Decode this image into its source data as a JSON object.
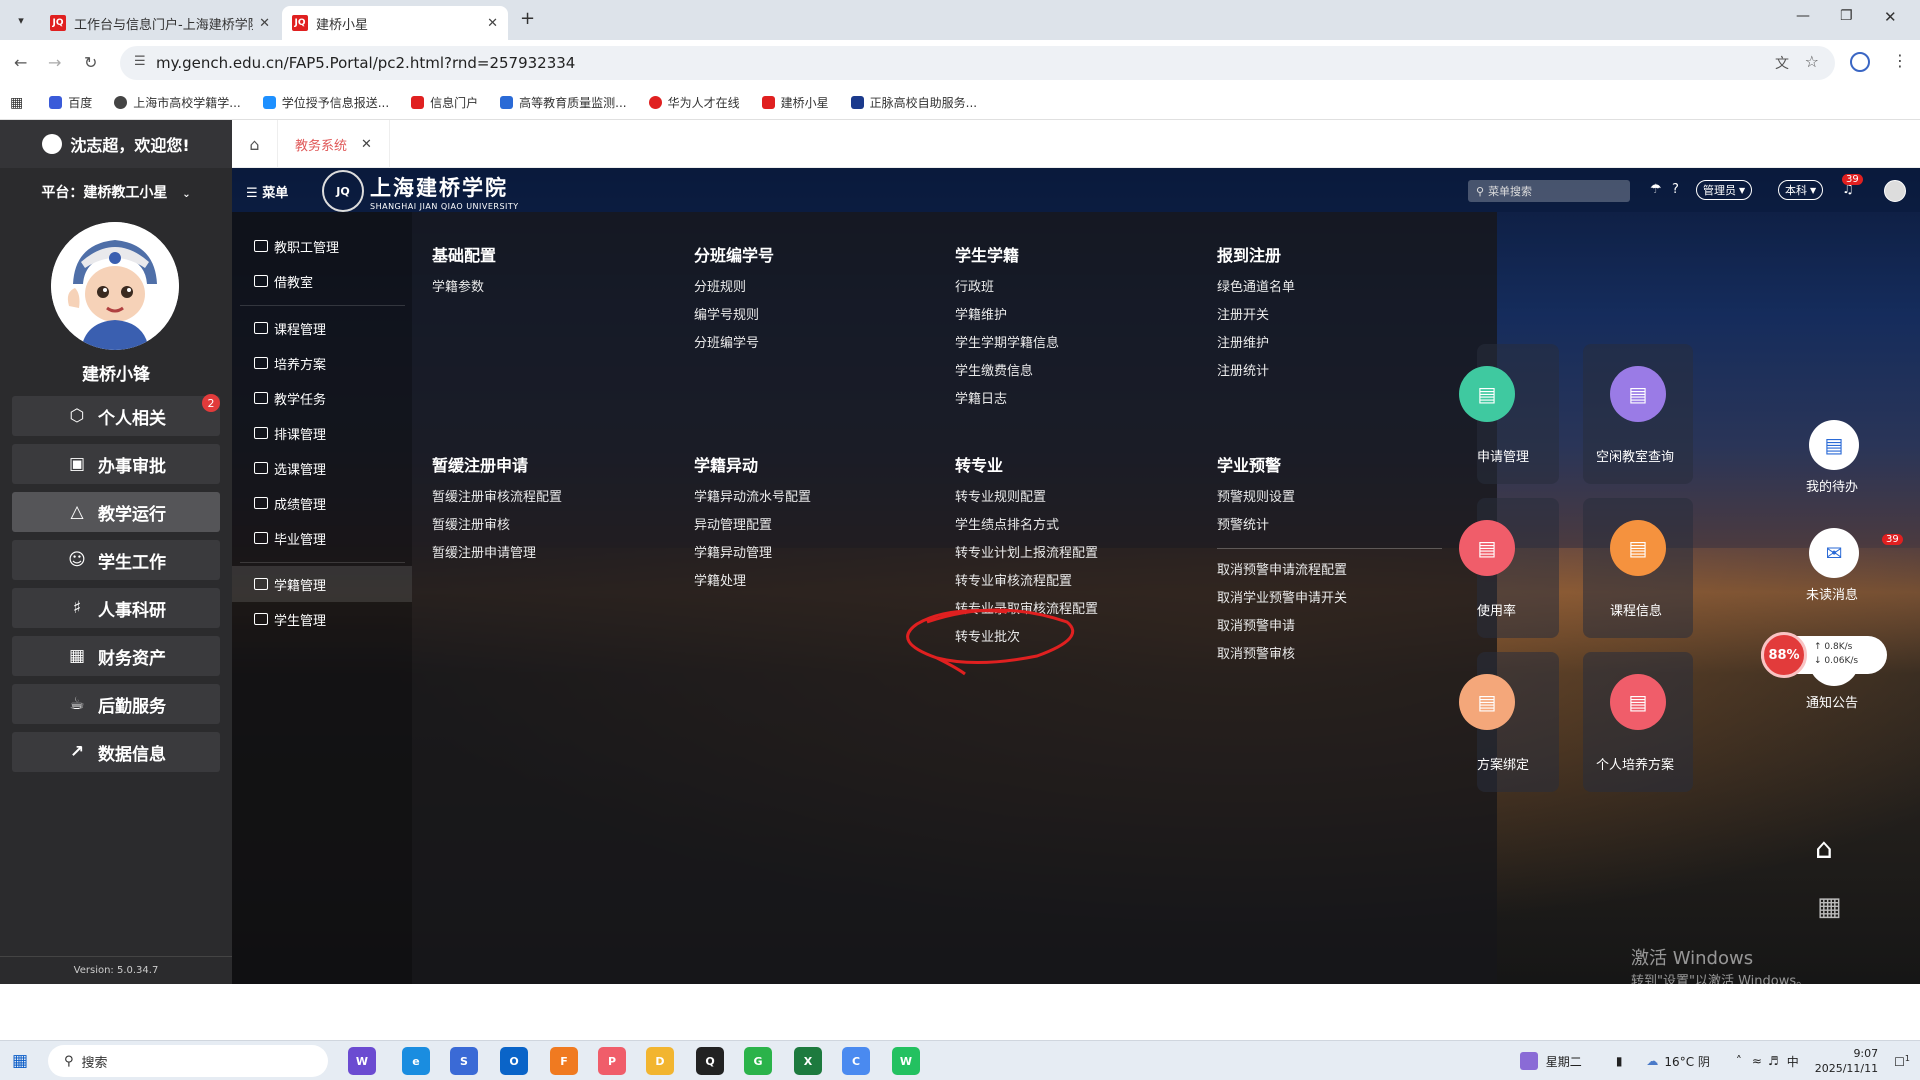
{
  "browser": {
    "tabs": [
      {
        "label": "工作台与信息门户-上海建桥学院",
        "favicon": "JQ"
      },
      {
        "label": "建桥小星",
        "favicon": "JQ"
      }
    ],
    "url": "my.gench.edu.cn/FAP5.Portal/pc2.html?rnd=257932334",
    "bookmarks": [
      {
        "label": "百度",
        "color": "#3a5bd9"
      },
      {
        "label": "上海市高校学籍学...",
        "color": "#444444"
      },
      {
        "label": "学位授予信息报送...",
        "color": "#1e90ff"
      },
      {
        "label": "信息门户",
        "color": "#e02020"
      },
      {
        "label": "高等教育质量监测...",
        "color": "#2a6ad6"
      },
      {
        "label": "华为人才在线",
        "color": "#e02020"
      },
      {
        "label": "建桥小星",
        "color": "#e02020"
      },
      {
        "label": "正脉高校自助服务...",
        "color": "#1b3a8c"
      }
    ]
  },
  "sidebar": {
    "greeting": "沈志超，欢迎您!",
    "platform": "平台：建桥教工小星",
    "name": "建桥小锋",
    "badge": "2",
    "items": [
      {
        "label": "个人相关",
        "icon": "cube-icon"
      },
      {
        "label": "办事审批",
        "icon": "briefcase-icon"
      },
      {
        "label": "教学运行",
        "icon": "graduation-icon"
      },
      {
        "label": "学生工作",
        "icon": "users-icon"
      },
      {
        "label": "人事科研",
        "icon": "org-icon"
      },
      {
        "label": "财务资产",
        "icon": "grid-icon"
      },
      {
        "label": "后勤服务",
        "icon": "cup-icon"
      },
      {
        "label": "数据信息",
        "icon": "chart-icon"
      }
    ],
    "version": "Version: 5.0.34.7"
  },
  "apptabs": {
    "system": "教务系统"
  },
  "topbar": {
    "menu": "菜单",
    "logo_cn": "上海建桥学院",
    "logo_en": "SHANGHAI JIAN QIAO UNIVERSITY",
    "search_placeholder": "菜单搜索",
    "role": "管理员",
    "level": "本科",
    "bell_count": "39"
  },
  "leftmenu": [
    "教职工管理",
    "借教室",
    "课程管理",
    "培养方案",
    "教学任务",
    "排课管理",
    "选课管理",
    "成绩管理",
    "毕业管理",
    "学籍管理",
    "学生管理"
  ],
  "megamenu": {
    "groups": [
      {
        "title": "基础配置",
        "links": [
          "学籍参数"
        ]
      },
      {
        "title": "分班编学号",
        "links": [
          "分班规则",
          "编学号规则",
          "分班编学号"
        ]
      },
      {
        "title": "学生学籍",
        "links": [
          "行政班",
          "学籍维护",
          "学生学期学籍信息",
          "学生缴费信息",
          "学籍日志"
        ]
      },
      {
        "title": "报到注册",
        "links": [
          "绿色通道名单",
          "注册开关",
          "注册维护",
          "注册统计"
        ]
      },
      {
        "title": "暂缓注册申请",
        "links": [
          "暂缓注册审核流程配置",
          "暂缓注册审核",
          "暂缓注册申请管理"
        ]
      },
      {
        "title": "学籍异动",
        "links": [
          "学籍异动流水号配置",
          "异动管理配置",
          "学籍异动管理",
          "学籍处理"
        ]
      },
      {
        "title": "转专业",
        "links": [
          "转专业规则配置",
          "学生绩点排名方式",
          "转专业计划上报流程配置",
          "转专业审核流程配置",
          "转专业录取审核流程配置",
          "转专业批次"
        ]
      },
      {
        "title": "学业预警",
        "links": [
          "预警规则设置",
          "预警统计"
        ]
      }
    ],
    "extra_links": [
      "取消预警申请流程配置",
      "取消学业预警申请开关",
      "取消预警申请",
      "取消预警审核"
    ]
  },
  "cards": [
    {
      "label": "申请管理",
      "color": "#3fc9a0"
    },
    {
      "label": "空闲教室查询",
      "color": "#9a7be6"
    },
    {
      "label": "使用率",
      "color": "#f05d6a"
    },
    {
      "label": "课程信息",
      "color": "#f5923e"
    },
    {
      "label": "方案绑定",
      "color": "#f4a77a"
    },
    {
      "label": "个人培养方案",
      "color": "#f05d6a"
    }
  ],
  "fabs": [
    {
      "label": "我的待办"
    },
    {
      "label": "未读消息",
      "badge": "39"
    },
    {
      "label": "通知公告"
    }
  ],
  "network": {
    "percent": "88%",
    "up": "0.8K/s",
    "down": "0.06K/s"
  },
  "watermark": {
    "line1": "激活 Windows",
    "line2": "转到\"设置\"以激活 Windows。"
  },
  "taskbar": {
    "search": "搜索",
    "weekday": "星期二",
    "weather": "16°C 阴",
    "ime": "中",
    "time": "9:07",
    "date": "2025/11/11",
    "notif": "1"
  }
}
